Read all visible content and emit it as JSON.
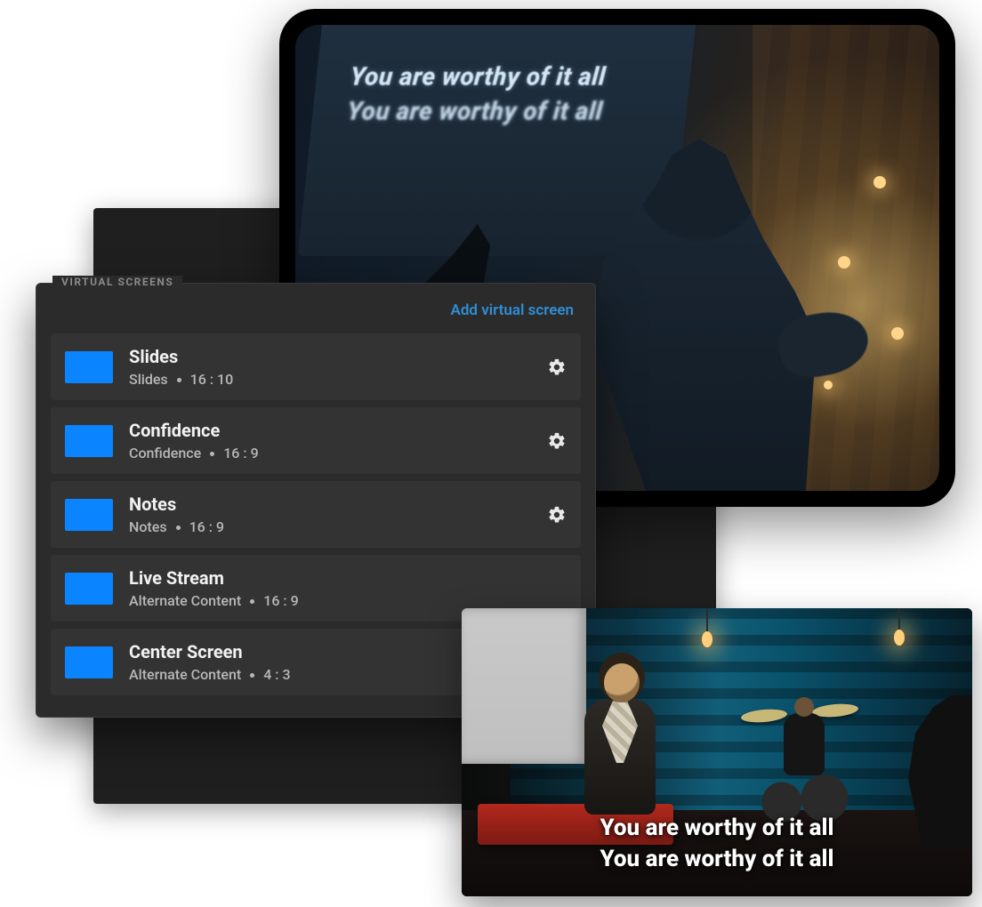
{
  "tablet": {
    "lyric_line_1": "You are worthy of it all",
    "lyric_line_2": "You are worthy of it all"
  },
  "panel": {
    "title": "VIRTUAL SCREENS",
    "add_label": "Add virtual screen",
    "screens": [
      {
        "name": "Slides",
        "layout": "Slides",
        "aspect": "16 : 10",
        "has_settings": true
      },
      {
        "name": "Confidence",
        "layout": "Confidence",
        "aspect": "16 : 9",
        "has_settings": true
      },
      {
        "name": "Notes",
        "layout": "Notes",
        "aspect": "16 : 9",
        "has_settings": true
      },
      {
        "name": "Live Stream",
        "layout": "Alternate Content",
        "aspect": "16 : 9",
        "has_settings": false
      },
      {
        "name": "Center Screen",
        "layout": "Alternate Content",
        "aspect": "4 : 3",
        "has_settings": false
      }
    ]
  },
  "stagephoto": {
    "lyric_line_1": "You are worthy of it all",
    "lyric_line_2": "You are worthy of it all"
  }
}
